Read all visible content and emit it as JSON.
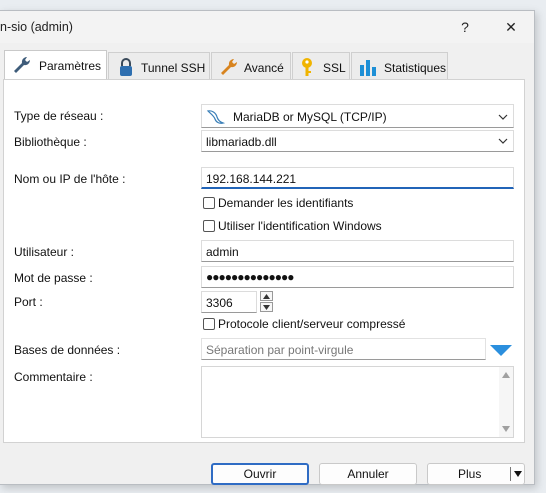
{
  "window": {
    "title": "n-sio (admin)",
    "help_label": "?",
    "close_label": "✕"
  },
  "tabs": [
    {
      "label": "Paramètres",
      "icon": "wrench-icon"
    },
    {
      "label": "Tunnel SSH",
      "icon": "lock-icon"
    },
    {
      "label": "Avancé",
      "icon": "wrench-orange-icon"
    },
    {
      "label": "SSL",
      "icon": "key-icon"
    },
    {
      "label": "Statistiques",
      "icon": "bar-chart-icon"
    }
  ],
  "form": {
    "network_type_label": "Type de réseau :",
    "network_type_value": "MariaDB or MySQL (TCP/IP)",
    "library_label": "Bibliothèque :",
    "library_value": "libmariadb.dll",
    "host_label": "Nom ou IP de l'hôte :",
    "host_value": "192.168.144.221",
    "prompt_credentials_label": "Demander les identifiants",
    "windows_auth_label": "Utiliser l'identification Windows",
    "user_label": "Utilisateur :",
    "user_value": "admin",
    "password_label": "Mot de passe :",
    "password_value": "●●●●●●●●●●●●●●",
    "port_label": "Port :",
    "port_value": "3306",
    "compression_label": "Protocole client/serveur compressé",
    "databases_label": "Bases de données :",
    "databases_placeholder": "Séparation par point-virgule",
    "comment_label": "Commentaire :"
  },
  "buttons": {
    "open": "Ouvrir",
    "cancel": "Annuler",
    "more": "Plus"
  },
  "colors": {
    "accent": "#2f6cc4",
    "focus_underline": "#2164b8"
  }
}
